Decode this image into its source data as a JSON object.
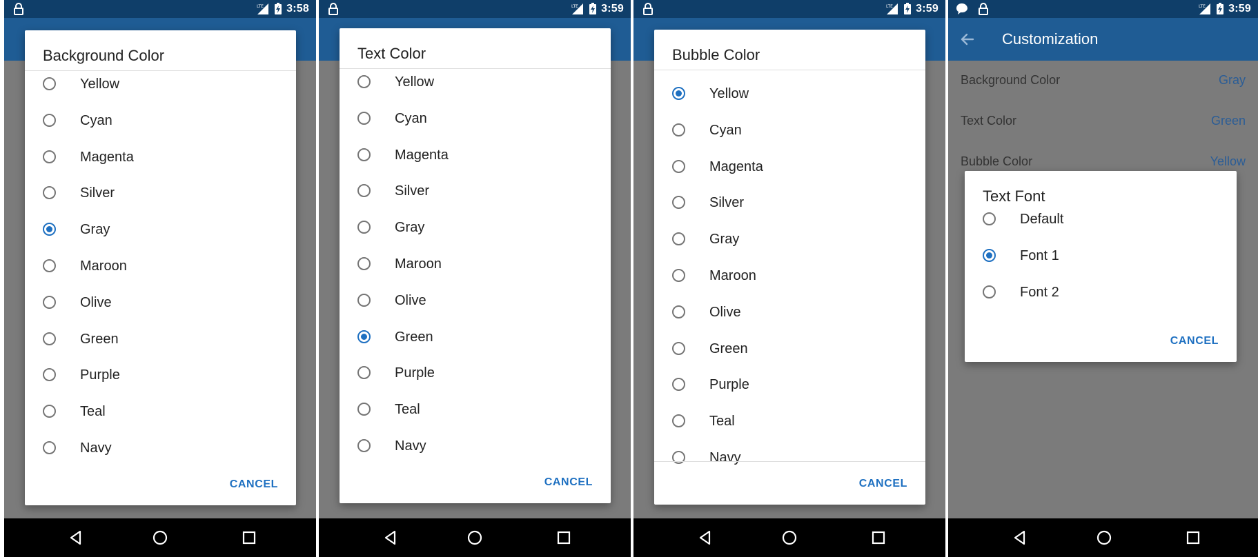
{
  "status_bar": [
    {
      "time": "3:58"
    },
    {
      "time": "3:59"
    },
    {
      "time": "3:59"
    },
    {
      "time": "3:59"
    }
  ],
  "status_icons": {
    "lock": "lock-icon",
    "signal": "lte-signal-icon",
    "battery": "battery-charging-icon",
    "message": "chat-bubble-icon"
  },
  "colors": {
    "accent": "#1e70c1",
    "status_bar": "#0f3e69",
    "app_bar": "#1f5c94",
    "scrim": "#7b7b7b"
  },
  "dialogs": [
    {
      "title": "Background Color",
      "options": [
        "Yellow",
        "Cyan",
        "Magenta",
        "Silver",
        "Gray",
        "Maroon",
        "Olive",
        "Green",
        "Purple",
        "Teal",
        "Navy"
      ],
      "selected": "Gray",
      "cancel": "CANCEL"
    },
    {
      "title": "Text Color",
      "options": [
        "Yellow",
        "Cyan",
        "Magenta",
        "Silver",
        "Gray",
        "Maroon",
        "Olive",
        "Green",
        "Purple",
        "Teal",
        "Navy"
      ],
      "selected": "Green",
      "cancel": "CANCEL"
    },
    {
      "title": "Bubble Color",
      "options": [
        "Yellow",
        "Cyan",
        "Magenta",
        "Silver",
        "Gray",
        "Maroon",
        "Olive",
        "Green",
        "Purple",
        "Teal",
        "Navy"
      ],
      "selected": "Yellow",
      "cancel": "CANCEL"
    },
    {
      "title": "Text Font",
      "options": [
        "Default",
        "Font 1",
        "Font 2"
      ],
      "selected": "Font 1",
      "cancel": "CANCEL"
    }
  ],
  "customization": {
    "title": "Customization",
    "prefs": [
      {
        "label": "Background Color",
        "value": "Gray"
      },
      {
        "label": "Text Color",
        "value": "Green"
      },
      {
        "label": "Bubble Color",
        "value": "Yellow"
      }
    ]
  }
}
